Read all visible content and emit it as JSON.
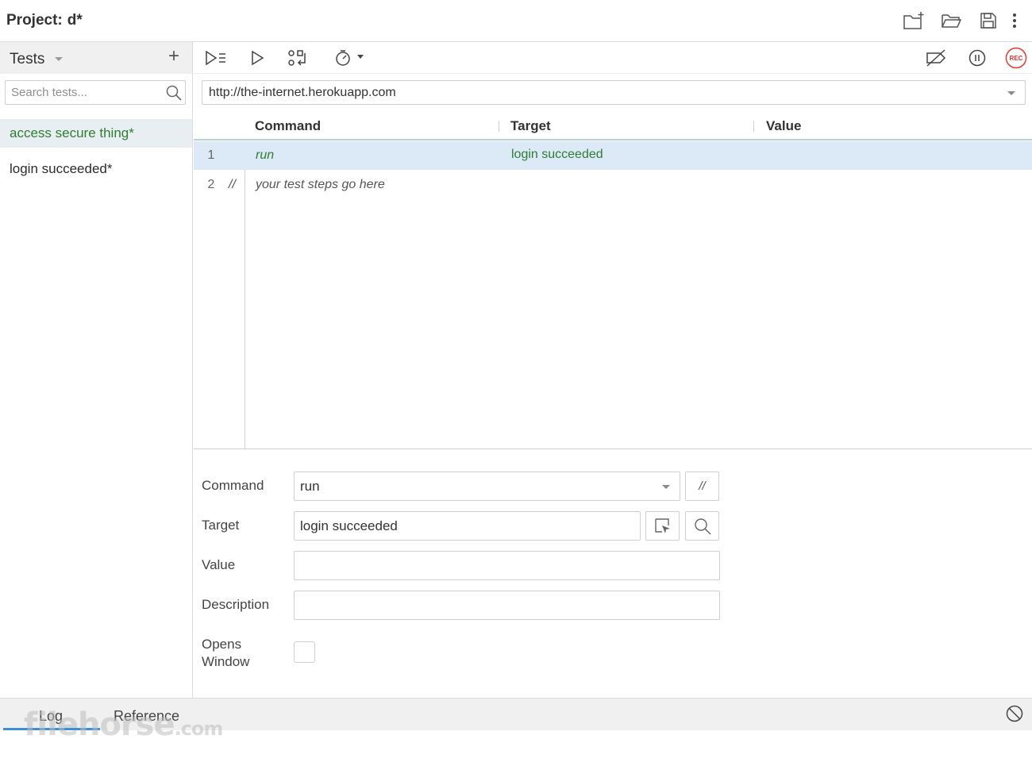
{
  "header": {
    "project_label": "Project:",
    "project_name": "d*",
    "icons": [
      "new-project-icon",
      "open-project-icon",
      "save-project-icon",
      "more-options-icon"
    ]
  },
  "sidebar": {
    "title": "Tests",
    "add_label": "+",
    "search_placeholder": "Search tests...",
    "tests": [
      {
        "name": "access secure thing*",
        "active": true
      },
      {
        "name": "login succeeded*",
        "active": false
      }
    ]
  },
  "toolbar": {
    "left_icons": [
      "run-all-tests-icon",
      "run-current-test-icon",
      "step-over-icon",
      "test-execution-speed-icon"
    ],
    "right_icons": [
      "disable-breakpoints-icon",
      "pause-on-exceptions-icon",
      "record-icon"
    ],
    "record_label": "REC"
  },
  "url": {
    "value": "http://the-internet.herokuapp.com"
  },
  "grid": {
    "columns": [
      "Command",
      "Target",
      "Value"
    ],
    "rows": [
      {
        "num": "1",
        "comment": "",
        "command": "run",
        "target": "login succeeded",
        "value": "",
        "selected": true
      },
      {
        "num": "2",
        "comment": "//",
        "command": "your test steps go here",
        "target": "",
        "value": "",
        "selected": false
      }
    ]
  },
  "editor": {
    "command_label": "Command",
    "command_value": "run",
    "comment_btn": "//",
    "target_label": "Target",
    "target_value": "login succeeded",
    "value_label": "Value",
    "value_value": "",
    "description_label": "Description",
    "description_value": "",
    "opens_window_label_1": "Opens",
    "opens_window_label_2": "Window",
    "opens_window_checked": false
  },
  "bottom": {
    "tabs": [
      "Log",
      "Reference"
    ],
    "active_tab": "Log"
  },
  "watermark": {
    "text": "filehorse",
    "suffix": ".com"
  },
  "colors": {
    "accent_green": "#2e7d32",
    "selected_row": "#dce9f7",
    "record_red": "#e53935",
    "tab_underline": "#3b8fd6"
  }
}
